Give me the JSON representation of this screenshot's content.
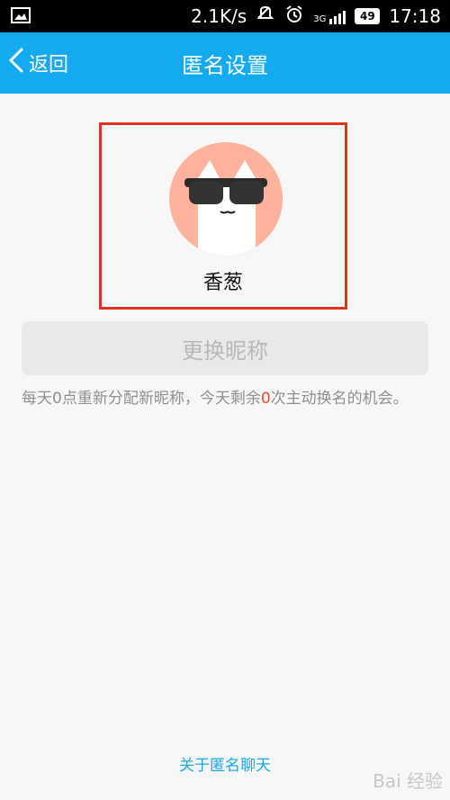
{
  "status_bar": {
    "speed": "2.1K/s",
    "signal_tag": "3G",
    "battery": "49",
    "time": "17:18"
  },
  "navbar": {
    "back_label": "返回",
    "title": "匿名设置"
  },
  "profile": {
    "nickname": "香葱"
  },
  "actions": {
    "change_nickname_label": "更换昵称"
  },
  "hint": {
    "text_before": "每天0点重新分配新昵称，今天剩余",
    "remaining": "0",
    "text_after": "次主动换名的机会。"
  },
  "footer": {
    "about_label": "关于匿名聊天"
  },
  "watermark": {
    "text": "Bai 经验"
  },
  "colors": {
    "accent": "#14aaf0",
    "highlight": "#e0301e",
    "avatar_bg": "#ffb39d"
  }
}
